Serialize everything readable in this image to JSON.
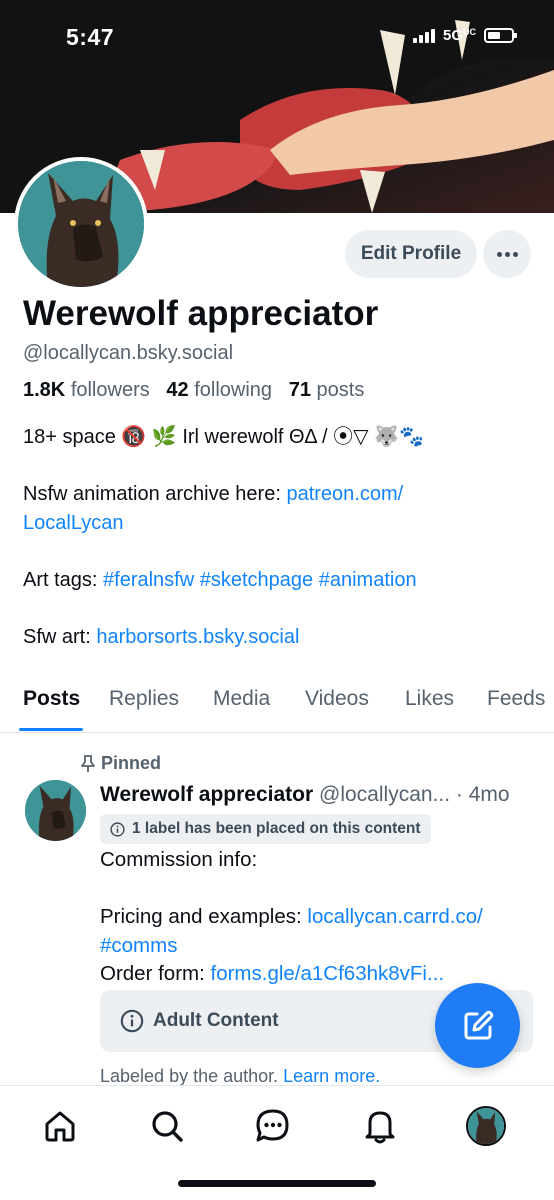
{
  "status_bar": {
    "time": "5:47",
    "network": "5G",
    "network_suffix": "UC"
  },
  "profile": {
    "display_name": "Werewolf appreciator",
    "handle": "@locallycan.bsky.social",
    "edit_button": "Edit Profile",
    "stats": {
      "followers_count": "1.8K",
      "followers_label": "followers",
      "following_count": "42",
      "following_label": "following",
      "posts_count": "71",
      "posts_label": "posts"
    },
    "bio": {
      "line1": "18+ space 🔞 🌿 Irl werewolf ΘΔ / ⦿▽ 🐺🐾",
      "archive_prefix": "Nsfw animation archive here: ",
      "archive_link_1": "patreon.com/",
      "archive_link_2": "LocalLycan",
      "art_tags_prefix": "Art tags: ",
      "tag_1": "#feralnsfw",
      "tag_2": "#sketchpage",
      "tag_3": "#animation",
      "sfw_prefix": "Sfw art: ",
      "sfw_link": "harborsorts.bsky.social"
    }
  },
  "tabs": [
    "Posts",
    "Replies",
    "Media",
    "Videos",
    "Likes",
    "Feeds"
  ],
  "post": {
    "pinned_label": "Pinned",
    "author_name": "Werewolf appreciator",
    "author_handle": "@locallycan...",
    "separator": " · ",
    "time": "4mo",
    "label_notice": "1 label has been placed on this content",
    "line1": "Commission info:",
    "pricing_prefix": "Pricing and examples: ",
    "pricing_link": "locallycan.carrd.co/",
    "pricing_link_2": "#comms",
    "order_prefix": "Order form: ",
    "order_link": "forms.gle/a1Cf63hk8vFi...",
    "adult_label": "Adult Content",
    "labeled_text": "Labeled by the author. ",
    "learn_more": "Learn more."
  },
  "colors": {
    "accent": "#1083fe",
    "fab": "#1f7cf5",
    "muted": "#56626e",
    "chip_bg": "#edf0f3"
  },
  "icons": [
    "home-icon",
    "search-icon",
    "chat-icon",
    "bell-icon",
    "profile-avatar",
    "compose-icon",
    "pin-icon",
    "info-icon",
    "more-icon"
  ]
}
